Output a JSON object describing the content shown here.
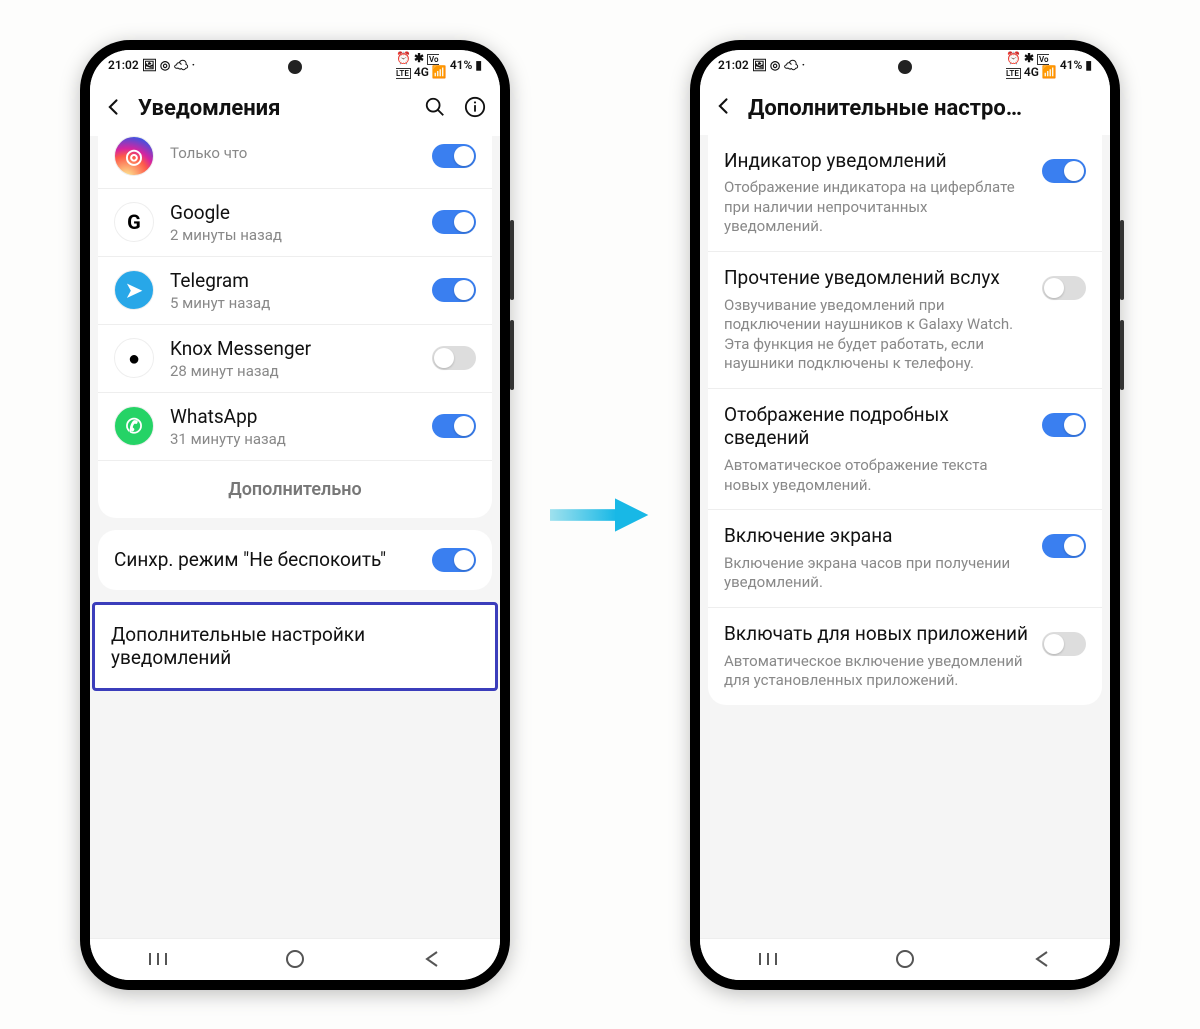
{
  "status": {
    "time": "21:02",
    "battery": "41%"
  },
  "phone1": {
    "title": "Уведомления",
    "apps": [
      {
        "name": "Instagram",
        "sub": "Только что",
        "on": true,
        "icon": "ig",
        "glyph": "◎",
        "cut": true
      },
      {
        "name": "Google",
        "sub": "2 минуты назад",
        "on": true,
        "icon": "google",
        "glyph": "G"
      },
      {
        "name": "Telegram",
        "sub": "5 минут назад",
        "on": true,
        "icon": "tg",
        "glyph": "➤"
      },
      {
        "name": "Knox Messenger",
        "sub": "28 минут назад",
        "on": false,
        "icon": "knox",
        "glyph": "●"
      },
      {
        "name": "WhatsApp",
        "sub": "31 минуту назад",
        "on": true,
        "icon": "wa",
        "glyph": "✆"
      }
    ],
    "more": "Дополнительно",
    "sync": "Синхр. режим \"Не беспокоить\"",
    "sync_on": true,
    "advanced_link": "Дополнительные настройки уведомлений"
  },
  "phone2": {
    "title": "Дополнительные настро…",
    "items": [
      {
        "title": "Индикатор уведомлений",
        "desc": "Отображение индикатора на циферблате при наличии непрочитанных уведомлений.",
        "on": true
      },
      {
        "title": "Прочтение уведомлений вслух",
        "desc": "Озвучивание уведомлений при подключении наушников к Galaxy Watch. Эта функция не будет работать, если наушники подключены к телефону.",
        "on": false
      },
      {
        "title": "Отображение подробных сведений",
        "desc": "Автоматическое отображение текста новых уведомлений.",
        "on": true
      },
      {
        "title": "Включение экрана",
        "desc": "Включение экрана часов при получении уведомлений.",
        "on": true
      },
      {
        "title": "Включать для новых приложений",
        "desc": "Автоматическое включение уведомлений для установленных приложений.",
        "on": false
      }
    ]
  }
}
